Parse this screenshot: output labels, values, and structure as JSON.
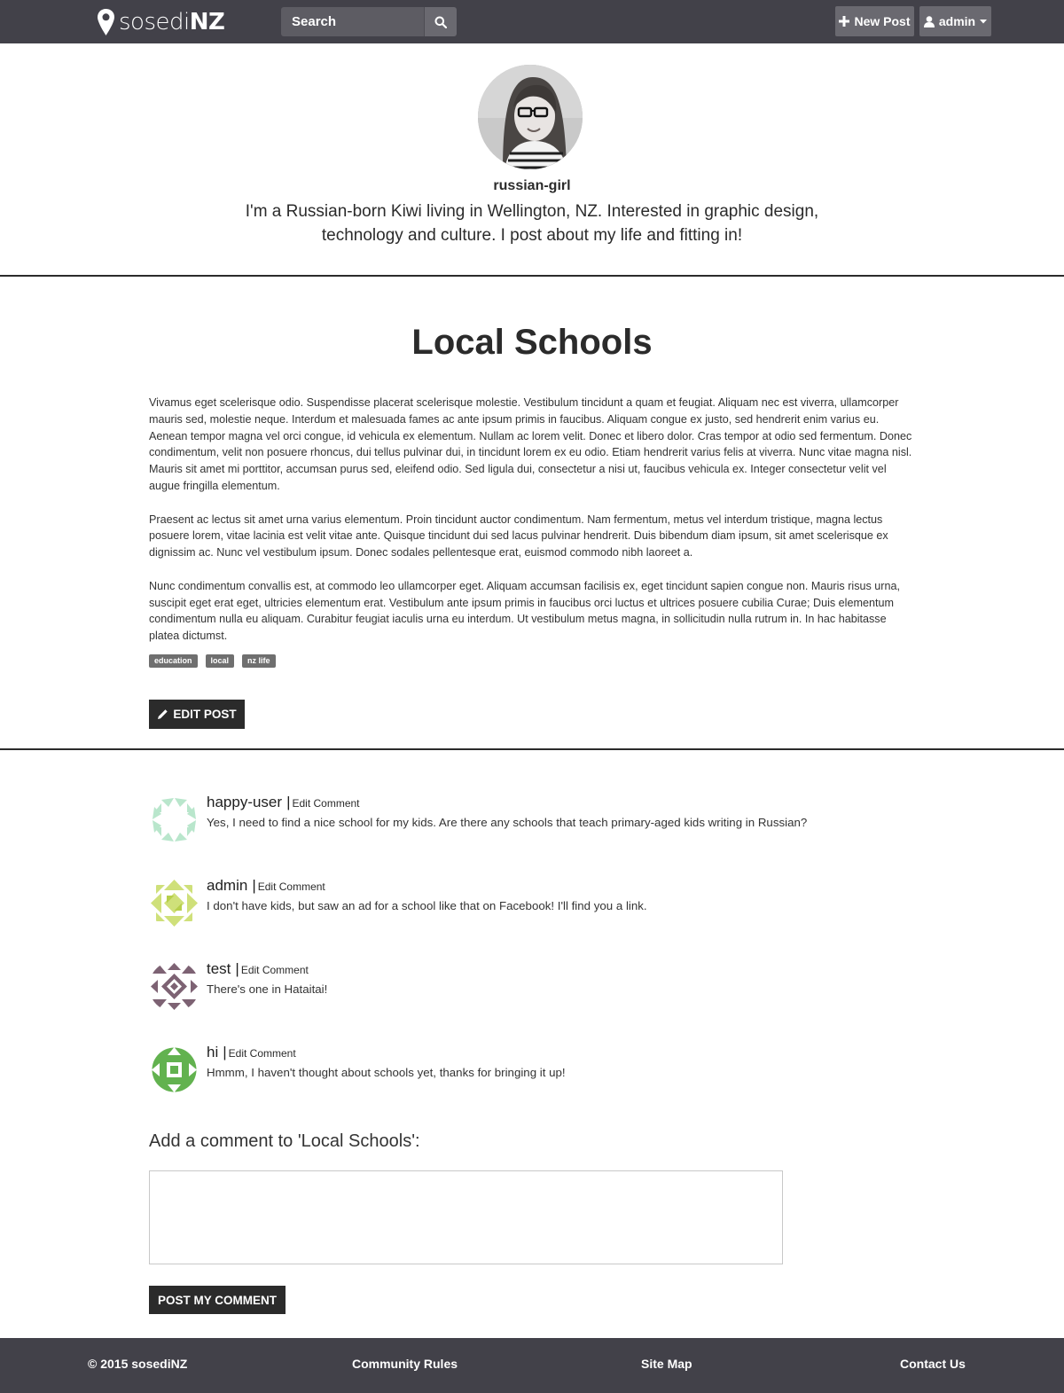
{
  "nav": {
    "brand_light": "sosedi",
    "brand_bold": "NZ",
    "search_placeholder": "Search",
    "new_post_label": "New Post",
    "user_label": "admin"
  },
  "profile": {
    "username": "russian-girl",
    "bio": "I'm a Russian-born Kiwi living in Wellington, NZ. Interested in graphic design, technology and culture. I post about my life and fitting in!"
  },
  "post": {
    "title": "Local Schools",
    "paragraphs": [
      "Vivamus eget scelerisque odio. Suspendisse placerat scelerisque molestie. Vestibulum tincidunt a quam et feugiat. Aliquam nec est viverra, ullamcorper mauris sed, molestie neque. Interdum et malesuada fames ac ante ipsum primis in faucibus. Aliquam congue ex justo, sed hendrerit enim varius eu. Aenean tempor magna vel orci congue, id vehicula ex elementum. Nullam ac lorem velit. Donec et libero dolor. Cras tempor at odio sed fermentum. Donec condimentum, velit non posuere rhoncus, dui tellus pulvinar dui, in tincidunt lorem ex eu odio. Etiam hendrerit varius felis at viverra. Nunc vitae magna nisl. Mauris sit amet mi porttitor, accumsan purus sed, eleifend odio. Sed ligula dui, consectetur a nisi ut, faucibus vehicula ex. Integer consectetur velit vel augue fringilla elementum.",
      "Praesent ac lectus sit amet urna varius elementum. Proin tincidunt auctor condimentum. Nam fermentum, metus vel interdum tristique, magna lectus posuere lorem, vitae lacinia est velit vitae ante. Quisque tincidunt dui sed lacus pulvinar hendrerit. Duis bibendum diam ipsum, sit amet scelerisque ex dignissim ac. Nunc vel vestibulum ipsum. Donec sodales pellentesque erat, euismod commodo nibh laoreet a.",
      "Nunc condimentum convallis est, at commodo leo ullamcorper eget. Aliquam accumsan facilisis ex, eget tincidunt sapien congue non. Mauris risus urna, suscipit eget erat eget, ultricies elementum erat. Vestibulum ante ipsum primis in faucibus orci luctus et ultrices posuere cubilia Curae; Duis elementum condimentum nulla eu aliquam. Curabitur feugiat iaculis urna eu interdum. Ut vestibulum metus magna, in sollicitudin nulla rutrum in. In hac habitasse platea dictumst."
    ],
    "tags": [
      "education",
      "local",
      "nz life"
    ],
    "edit_label": "EDIT POST"
  },
  "comments": [
    {
      "author": "happy-user",
      "edit_label": "Edit Comment",
      "text": "Yes, I need to find a nice school for my kids. Are there any schools that teach primary-aged kids writing in Russian?",
      "avatar_color": "#b9e6cc"
    },
    {
      "author": "admin",
      "edit_label": "Edit Comment",
      "text": "I don't have kids, but saw an ad for a school like that on Facebook! I'll find you a link.",
      "avatar_color": "#cfe07a"
    },
    {
      "author": "test",
      "edit_label": "Edit Comment",
      "text": "There's one in Hataitai!",
      "avatar_color": "#7d6273"
    },
    {
      "author": "hi",
      "edit_label": "Edit Comment",
      "text": "Hmmm, I haven't thought about schools yet, thanks for bringing it up!",
      "avatar_color": "#62b24f"
    }
  ],
  "comment_form": {
    "title": "Add a comment to 'Local Schools':",
    "placeholder": "",
    "submit_label": "POST MY COMMENT"
  },
  "footer": {
    "copyright": "© 2015 sosediNZ",
    "community_rules": "Community Rules",
    "site_map": "Site Map",
    "contact_us": "Contact Us"
  },
  "colors": {
    "navbar": "#424149",
    "button_dark": "#2b2b2b",
    "tag": "#6f6f6f"
  }
}
